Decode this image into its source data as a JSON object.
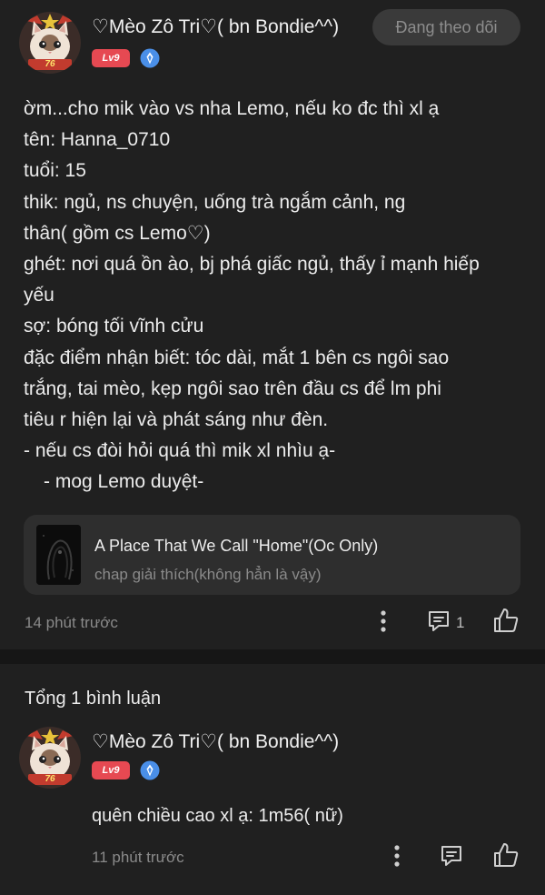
{
  "post": {
    "author": {
      "name": "♡Mèo Zô Tri♡( bn Bondie^^)",
      "level": "Lv9",
      "avatar_label": "76"
    },
    "follow_label": "Đang theo dõi",
    "body_lines": [
      "ờm...cho mik vào vs nha Lemo, nếu ko đc thì xl ạ",
      "tên: Hanna_0710",
      "tuổi: 15",
      "thik: ngủ, ns chuyện, uống trà ngắm cảnh, ng",
      "thân( gồm cs Lemo♡)",
      "ghét: nơi quá ồn ào, bj phá giấc ngủ, thấy ỉ mạnh hiếp",
      "yếu",
      "sợ: bóng tối vĩnh cửu",
      "đặc điểm nhận biết: tóc dài, mắt 1 bên cs ngôi sao",
      "trắng, tai mèo, kẹp ngôi sao trên đầu cs để lm phi",
      "tiêu r hiện lại và phát sáng như đèn.",
      "- nếu cs đòi hỏi quá thì mik xl nhìu ạ-",
      "- mog Lemo duyệt-"
    ],
    "shared_story": {
      "title": "A Place That We Call \"Home\"(Oc Only)",
      "subtitle": "chap giải thích(không hẳn là vậy)"
    },
    "time": "14 phút trước",
    "comment_count": "1"
  },
  "comments_section": {
    "total_label": "Tổng 1 bình luận",
    "comments": [
      {
        "author": {
          "name": "♡Mèo Zô Tri♡( bn Bondie^^)",
          "level": "Lv9",
          "avatar_label": "76"
        },
        "text": "quên chiều cao xl ạ: 1m56( nữ)",
        "time": "11 phút trước"
      }
    ]
  },
  "colors": {
    "background": "#202020",
    "text": "#ececec",
    "muted": "#8a8a8a",
    "level_badge": "#e64952",
    "verify_badge": "#4a8fe8"
  },
  "icons": [
    "verified-badge-icon",
    "more-vertical-icon",
    "comment-icon",
    "thumbs-up-icon"
  ]
}
